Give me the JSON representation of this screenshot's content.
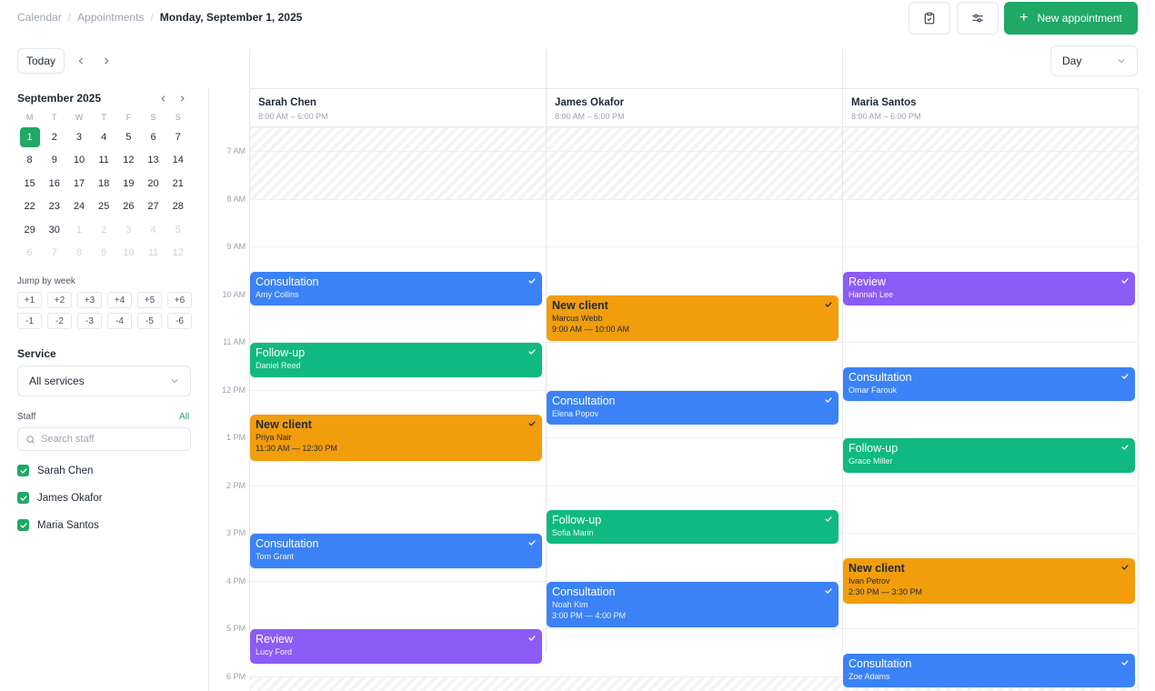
{
  "breadcrumb": {
    "items": [
      "Calendar",
      "Appointments"
    ],
    "current": "Monday, September 1, 2025"
  },
  "header": {
    "new_label": "New appointment",
    "clipboard_icon": "clipboard-check-icon",
    "filter_icon": "sliders-icon"
  },
  "toolbar": {
    "today_label": "Today",
    "view_value": "Day"
  },
  "mini_calendar": {
    "title": "September 2025",
    "weekdays": [
      "M",
      "T",
      "W",
      "T",
      "F",
      "S",
      "S"
    ],
    "weeks": [
      [
        "1",
        "2",
        "3",
        "4",
        "5",
        "6",
        "7"
      ],
      [
        "8",
        "9",
        "10",
        "11",
        "12",
        "13",
        "14"
      ],
      [
        "15",
        "16",
        "17",
        "18",
        "19",
        "20",
        "21"
      ],
      [
        "22",
        "23",
        "24",
        "25",
        "26",
        "27",
        "28"
      ],
      [
        "29",
        "30",
        "1",
        "2",
        "3",
        "4",
        "5"
      ],
      [
        "6",
        "7",
        "8",
        "9",
        "10",
        "11",
        "12"
      ]
    ],
    "selected": "1"
  },
  "jump": {
    "label": "Jump by week",
    "forward": [
      "+1",
      "+2",
      "+3",
      "+4",
      "+5",
      "+6"
    ],
    "back": [
      "-1",
      "-2",
      "-3",
      "-4",
      "-5",
      "-6"
    ]
  },
  "service": {
    "label": "Service",
    "value": "All services"
  },
  "staff_filter": {
    "label": "Staff",
    "all_label": "All",
    "search_placeholder": "Search staff",
    "members": [
      "Sarah Chen",
      "James Okafor",
      "Maria Santos"
    ]
  },
  "columns": [
    {
      "name": "Sarah Chen",
      "hours": "8:00 AM – 6:00 PM"
    },
    {
      "name": "James Okafor",
      "hours": "8:00 AM – 6:00 PM"
    },
    {
      "name": "Maria Santos",
      "hours": "8:00 AM – 6:00 PM"
    }
  ],
  "time_labels": [
    "7 AM",
    "8 AM",
    "9 AM",
    "10 AM",
    "11 AM",
    "12 PM",
    "1 PM",
    "2 PM",
    "3 PM",
    "4 PM",
    "5 PM",
    "6 PM"
  ],
  "colors": {
    "accent": "#1fa866",
    "consultation": "#3b82f6",
    "follow_up": "#10b981",
    "new_client": "#f29d0c",
    "review": "#8b5cf6"
  },
  "appointments": [
    {
      "col": 0,
      "start": 9.5,
      "end": 10.25,
      "title": "Consultation",
      "client": "Amy Collins",
      "time": "",
      "color": "blue"
    },
    {
      "col": 0,
      "start": 11.0,
      "end": 11.75,
      "title": "Follow-up",
      "client": "Daniel Reed",
      "time": "",
      "color": "green"
    },
    {
      "col": 0,
      "start": 12.5,
      "end": 13.5,
      "title": "New client",
      "client": "Priya Nair",
      "time": "11:30 AM — 12:30 PM",
      "color": "orange"
    },
    {
      "col": 0,
      "start": 15.0,
      "end": 15.75,
      "title": "Consultation",
      "client": "Tom Grant",
      "time": "",
      "color": "blue"
    },
    {
      "col": 0,
      "start": 17.0,
      "end": 17.75,
      "title": "Review",
      "client": "Lucy Ford",
      "time": "",
      "color": "purple"
    },
    {
      "col": 1,
      "start": 10.0,
      "end": 11.0,
      "title": "New client",
      "client": "Marcus Webb",
      "time": "9:00 AM — 10:00 AM",
      "color": "orange"
    },
    {
      "col": 1,
      "start": 12.0,
      "end": 12.75,
      "title": "Consultation",
      "client": "Elena Popov",
      "time": "",
      "color": "blue"
    },
    {
      "col": 1,
      "start": 14.5,
      "end": 15.25,
      "title": "Follow-up",
      "client": "Sofia Marin",
      "time": "",
      "color": "green"
    },
    {
      "col": 1,
      "start": 16.0,
      "end": 17.0,
      "title": "Consultation",
      "client": "Noah Kim",
      "time": "3:00 PM — 4:00 PM",
      "color": "blue"
    },
    {
      "col": 2,
      "start": 9.5,
      "end": 10.25,
      "title": "Review",
      "client": "Hannah Lee",
      "time": "",
      "color": "purple"
    },
    {
      "col": 2,
      "start": 11.5,
      "end": 12.25,
      "title": "Consultation",
      "client": "Omar Farouk",
      "time": "",
      "color": "blue"
    },
    {
      "col": 2,
      "start": 13.0,
      "end": 13.75,
      "title": "Follow-up",
      "client": "Grace Miller",
      "time": "",
      "color": "green"
    },
    {
      "col": 2,
      "start": 15.5,
      "end": 16.5,
      "title": "New client",
      "client": "Ivan Petrov",
      "time": "2:30 PM — 3:30 PM",
      "color": "orange"
    },
    {
      "col": 2,
      "start": 17.5,
      "end": 18.25,
      "title": "Consultation",
      "client": "Zoe Adams",
      "time": "",
      "color": "blue"
    }
  ]
}
